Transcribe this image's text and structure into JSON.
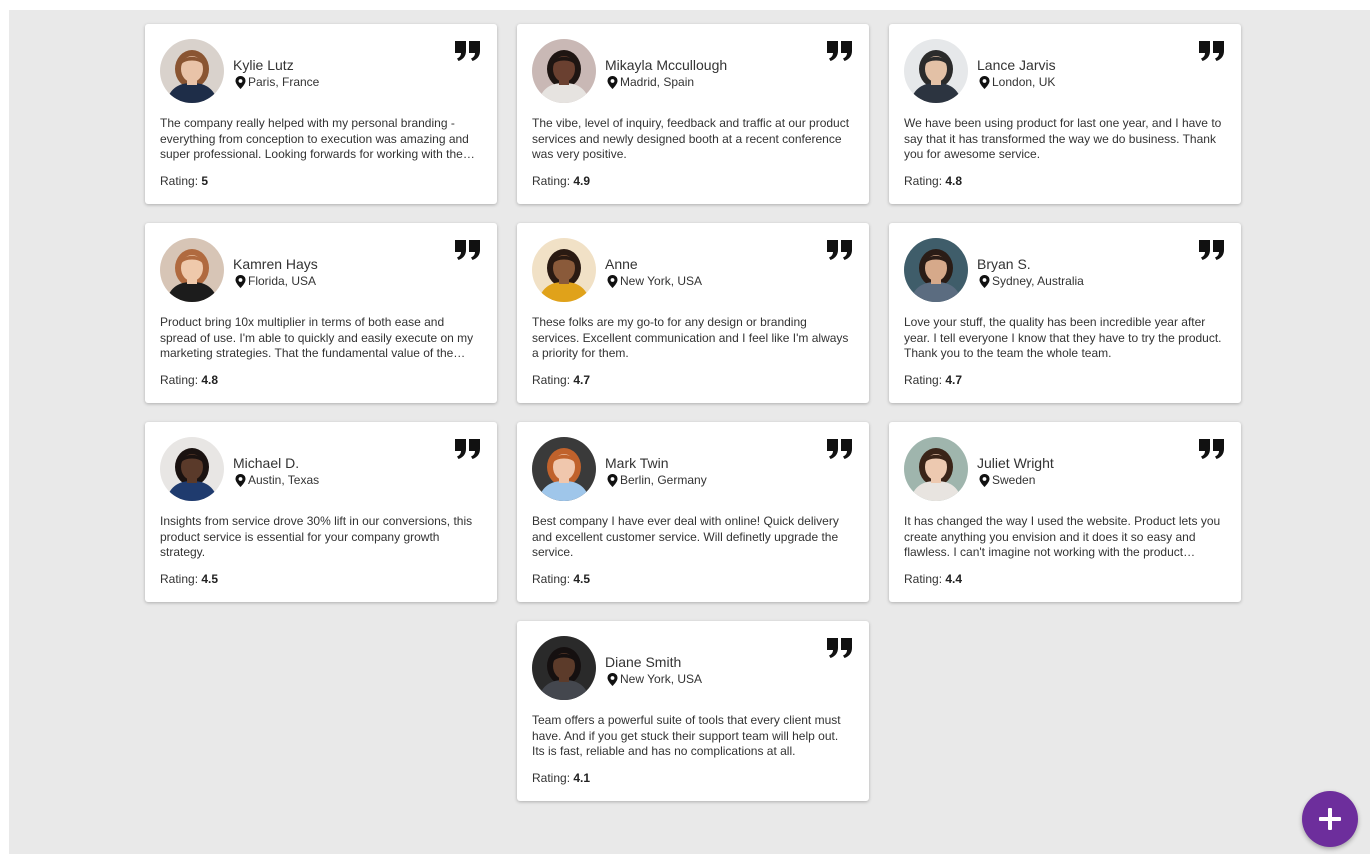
{
  "testimonials": [
    {
      "name": "Kylie Lutz",
      "location": "Paris, France",
      "text": "The company really helped with my personal branding - everything from conception to execution was amazing and super professional. Looking forwards for working with them again.",
      "rating_label": "Rating:",
      "rating": "5",
      "colors": {
        "bg": "#d9d2cc",
        "skin": "#e9c3a8",
        "hair": "#8a5532",
        "shirt": "#1e2d48"
      }
    },
    {
      "name": "Mikayla Mccullough",
      "location": "Madrid, Spain",
      "text": "The vibe, level of inquiry, feedback and traffic at our product services and newly designed booth at a recent conference was very positive.",
      "rating_label": "Rating:",
      "rating": "4.9",
      "colors": {
        "bg": "#c9b8b5",
        "skin": "#6a4030",
        "hair": "#1e1512",
        "shirt": "#e6e3e0"
      }
    },
    {
      "name": "Lance Jarvis",
      "location": "London, UK",
      "text": "We have been using product for last one year, and I have to say that it has transformed the way we do business. Thank you for awesome service.",
      "rating_label": "Rating:",
      "rating": "4.8",
      "colors": {
        "bg": "#e6e8ea",
        "skin": "#e3c1a6",
        "hair": "#2b2b2b",
        "shirt": "#2c3440"
      }
    },
    {
      "name": "Kamren Hays",
      "location": "Florida, USA",
      "text": "Product bring 10x multiplier in terms of both ease and spread of use. I'm able to quickly and easily execute on my marketing strategies. That the fundamental value of the service.",
      "rating_label": "Rating:",
      "rating": "4.8",
      "colors": {
        "bg": "#d7c5b6",
        "skin": "#efc9ab",
        "hair": "#b06a3f",
        "shirt": "#1c1c1c"
      }
    },
    {
      "name": "Anne",
      "location": "New York, USA",
      "text": "These folks are my go-to for any design or branding services. Excellent communication and I feel like I'm always a priority for them.",
      "rating_label": "Rating:",
      "rating": "4.7",
      "colors": {
        "bg": "#f1e1c6",
        "skin": "#8a5a3a",
        "hair": "#2a1a12",
        "shirt": "#e0a21a"
      }
    },
    {
      "name": "Bryan S.",
      "location": "Sydney, Australia",
      "text": "Love your stuff, the quality has been incredible year after year. I tell everyone I know that they have to try the product. Thank you to the team the whole team.",
      "rating_label": "Rating:",
      "rating": "4.7",
      "colors": {
        "bg": "#3f5d6a",
        "skin": "#d6a98a",
        "hair": "#2a1c16",
        "shirt": "#5b6c80"
      }
    },
    {
      "name": "Michael D.",
      "location": "Austin, Texas",
      "text": "Insights from service drove 30% lift in our conversions, this product service is essential for your company growth strategy.",
      "rating_label": "Rating:",
      "rating": "4.5",
      "colors": {
        "bg": "#e8e6e4",
        "skin": "#5a3a2a",
        "hair": "#1a1210",
        "shirt": "#1f3b6e"
      }
    },
    {
      "name": "Mark Twin",
      "location": "Berlin, Germany",
      "text": "Best company I have ever deal with online! Quick delivery and excellent customer service. Will definetly upgrade the service.",
      "rating_label": "Rating:",
      "rating": "4.5",
      "colors": {
        "bg": "#3a3a3a",
        "skin": "#f0c7ad",
        "hair": "#c0622c",
        "shirt": "#9fc6ea"
      }
    },
    {
      "name": "Juliet Wright",
      "location": "Sweden",
      "text": "It has changed the way I used the website. Product lets you create anything you envision and it does it so easy and flawless. I can't imagine not working with the product anymore.",
      "rating_label": "Rating:",
      "rating": "4.4",
      "colors": {
        "bg": "#9fb5ad",
        "skin": "#edc9b0",
        "hair": "#3a2418",
        "shirt": "#e8e4e0"
      }
    },
    {
      "name": "Diane Smith",
      "location": "New York, USA",
      "text": "Team offers a powerful suite of tools that every client must have. And if you get stuck their support team will help out. Its is fast, reliable and has no complications at all.",
      "rating_label": "Rating:",
      "rating": "4.1",
      "colors": {
        "bg": "#2a2a2a",
        "skin": "#5c3b2a",
        "hair": "#151010",
        "shirt": "#44474e"
      }
    }
  ],
  "icons": {
    "avatar": "avatar-photo",
    "location": "location-pin-icon",
    "quote": "quote-icon",
    "fab": "plus-icon"
  },
  "colors": {
    "page_bg": "#e9e9e9",
    "card_bg": "#ffffff",
    "text": "#333333",
    "fab": "#6d2e9c"
  }
}
